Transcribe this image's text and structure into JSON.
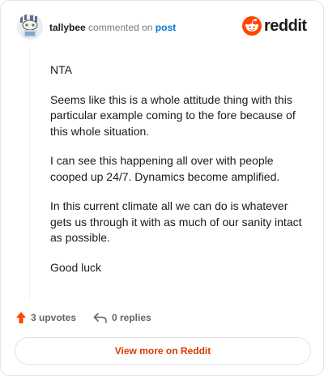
{
  "header": {
    "username": "tallybee",
    "action_text": "commented on",
    "post_link": "post",
    "brand": "reddit"
  },
  "comment": {
    "paragraphs": [
      "NTA",
      "Seems like this is a whole attitude thing with this particular example coming to the fore because of this whole situation.",
      "I can see this happening all over with people cooped up 24/7. Dynamics become amplified.",
      "In this current climate all we can do is whatever gets us through it with as much of our sanity intact as possible.",
      "Good luck"
    ]
  },
  "actions": {
    "upvotes": "3 upvotes",
    "replies": "0 replies"
  },
  "footer": {
    "view_more": "View more on Reddit"
  },
  "colors": {
    "brand_orange": "#ff4500",
    "link_blue": "#0079d3",
    "button_text": "#d93a00"
  },
  "icons": {
    "avatar": "snoo-avatar",
    "brand": "reddit-logo-icon",
    "upvote": "upvote-arrow-icon",
    "reply": "reply-arrow-icon"
  }
}
